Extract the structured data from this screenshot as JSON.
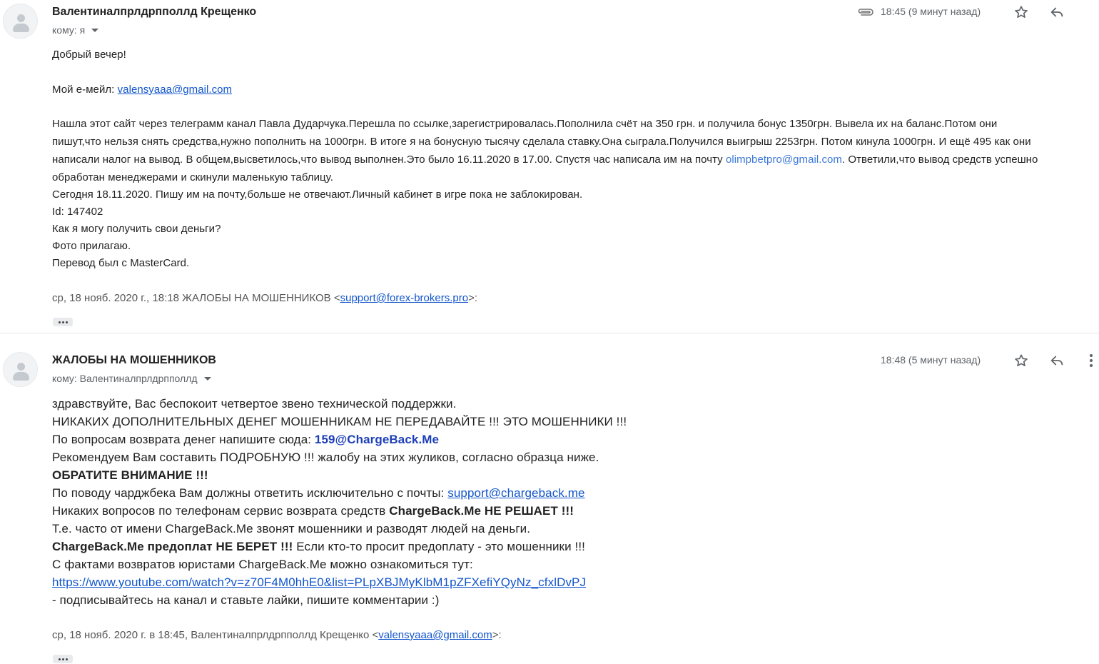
{
  "message1": {
    "sender": "Валентиналпрлдрпполлд Крещенко",
    "to_label": "кому: я",
    "time": "18:45 (9 минут назад)",
    "icons": [
      "paperclip-icon",
      "star-icon",
      "reply-icon"
    ],
    "body": {
      "greeting": "Добрый вечер!",
      "email_prefix": "Мой е-мейл: ",
      "email": "valensyaaa@gmail.com",
      "p1_line1": "Нашла этот сайт через телеграмм канал Павла Дударчука.Перешла по ссылке,зарегистрировалась.Пополнила счёт на 350 грн.  и получила бонус 1350грн. Вывела их на баланс.Потом они",
      "p1_line2": "пишут,что нельзя снять средства,нужно пополнить на 1000грн. В итоге я на бонусную тысячу сделала ставку.Она сыграла.Получился выигрыш 2253грн. Потом кинула 1000грн. И ещё 495 как они",
      "p1_line3_pre": "написали налог на вывод. В общем,высветилось,что вывод выполнен.Это было 16.11.2020 в 17.00. Спустя час написала им на почту ",
      "p1_line3_link": "olimpbetpro@gmail.com",
      "p1_line3_post": ". Ответили,что вывод средств успешно",
      "p1_line4": "обработан менеджерами и скинули маленькую таблицу.",
      "line_today": "Сегодня 18.11.2020. Пишу им на почту,больше не отвечают.Личный кабинет в игре пока не заблокирован.",
      "line_id": "Id: 147402",
      "line_question": "Как я могу получить свои деньги?",
      "line_photo": "Фото прилагаю.",
      "line_transfer": "Перевод был с MasterCard."
    },
    "quote": {
      "prefix": "ср, 18 нояб. 2020 г., 18:18 ЖАЛОБЫ НА МОШЕННИКОВ <",
      "email": "support@forex-brokers.pro",
      "suffix": ">:"
    }
  },
  "message2": {
    "sender": "ЖАЛОБЫ НА МОШЕННИКОВ",
    "to_label": "кому: Валентиналпрлдрпполлд",
    "time": "18:48 (5 минут назад)",
    "icons": [
      "star-icon",
      "reply-icon",
      "more-vert-icon"
    ],
    "body": {
      "l1": "здравствуйте, Вас беспокоит четвертое звено технической поддержки.",
      "l2": "НИКАКИХ ДОПОЛНИТЕЛЬНЫХ ДЕНЕГ МОШЕННИКАМ НЕ ПЕРЕДАВАЙТЕ !!! ЭТО МОШЕННИКИ !!!",
      "l3_pre": "По вопросам возврата денег напишите сюда: ",
      "l3_email": "159@ChargeBack.Me",
      "l4": "Рекомендуем Вам составить ПОДРОБНУЮ !!! жалобу на этих жуликов, согласно образца ниже.",
      "l5": "ОБРАТИТЕ ВНИМАНИЕ !!!",
      "l6_pre": "По поводу чарджбека Вам должны ответить исключительно с почты: ",
      "l6_email": "support@chargeback.me",
      "l7_pre": "Никаких вопросов по телефонам сервис возврата средств ",
      "l7_bold": "ChargeBack.Me НЕ РЕШАЕТ !!!",
      "l8": "Т.е. часто от имени ChargeBack.Me звонят мошенники и разводят людей на деньги.",
      "l9_bold": "ChargeBack.Me предоплат НЕ БЕРЕТ !!!",
      "l9_post": " Если кто-то просит предоплату - это мошенники !!!",
      "l10": "С фактами возвратов юристами ChargeBack.Me можно ознакомиться тут:",
      "l11_link": "https://www.youtube.com/watch?v=z70F4M0hhE0&list=PLpXBJMyKlbM1pZFXefiYQyNz_cfxlDvPJ",
      "l12": " - подписывайтесь на канал и ставьте лайки, пишите комментарии :)"
    },
    "quote": {
      "prefix": "ср, 18 нояб. 2020 г. в 18:45, Валентиналпрлдрпполлд Крещенко <",
      "email": "valensyaaa@gmail.com",
      "suffix": ">:"
    }
  }
}
